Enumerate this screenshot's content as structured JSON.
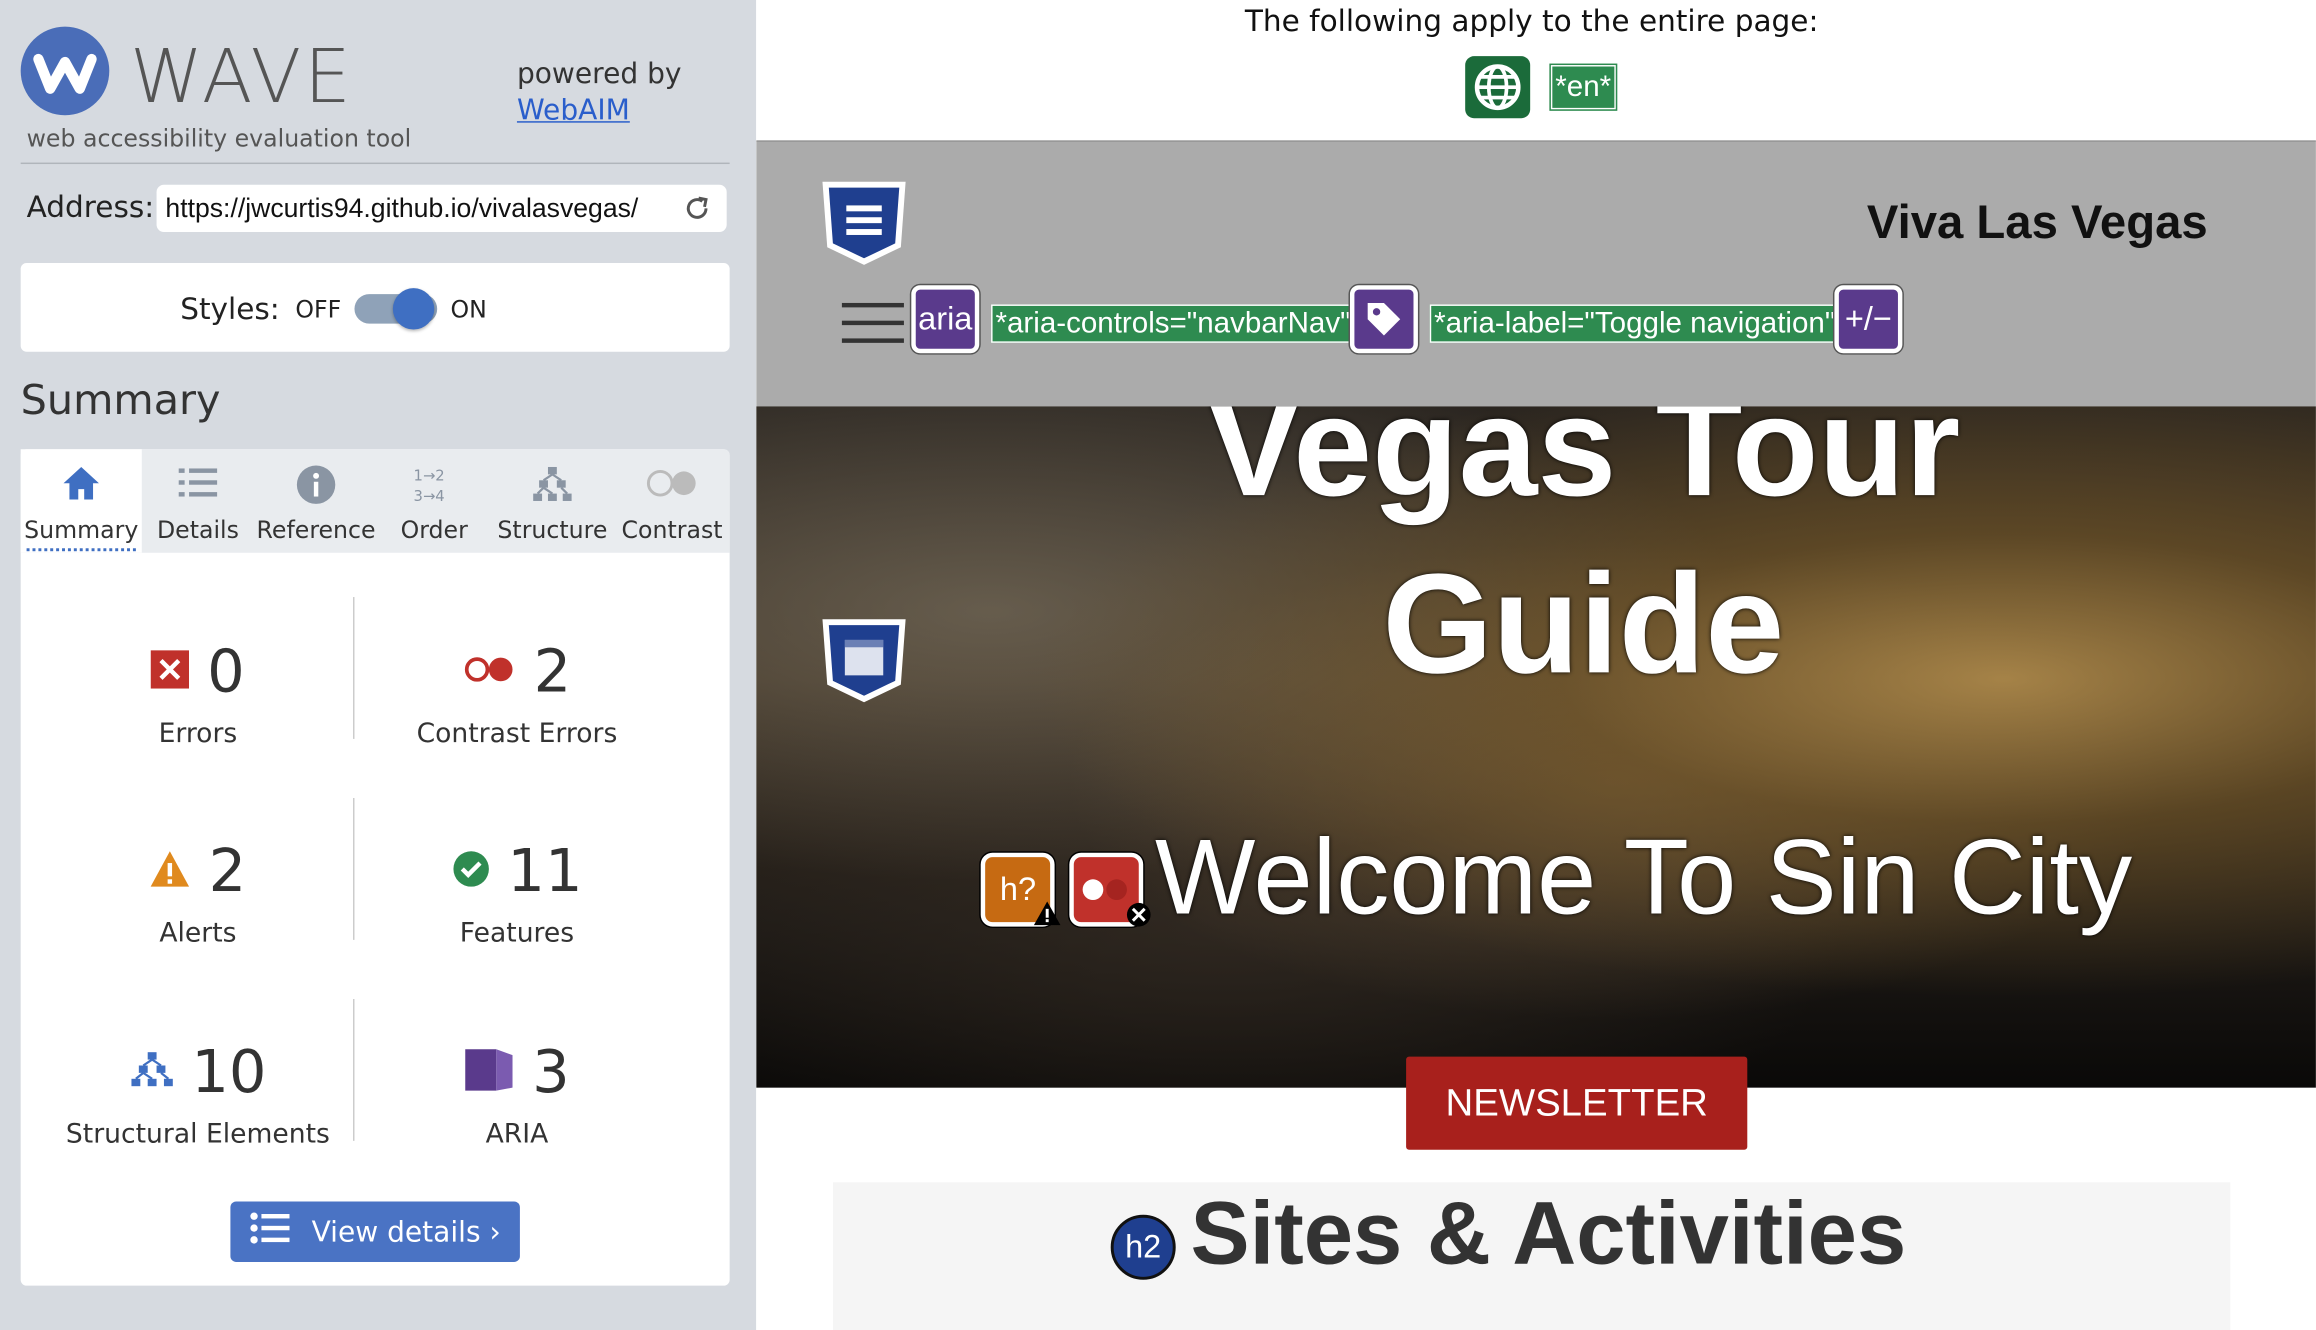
{
  "app": {
    "logo_text": "WAVE",
    "logo_subtitle": "web accessibility evaluation tool",
    "powered_by": "powered by",
    "powered_link": "WebAIM"
  },
  "address": {
    "label": "Address:",
    "value": "https://jwcurtis94.github.io/vivalasvegas/"
  },
  "styles": {
    "label": "Styles:",
    "off": "OFF",
    "on": "ON",
    "enabled": true
  },
  "summary": {
    "heading": "Summary",
    "tabs": [
      {
        "label": "Summary",
        "icon": "home-icon"
      },
      {
        "label": "Details",
        "icon": "list-icon"
      },
      {
        "label": "Reference",
        "icon": "info-icon"
      },
      {
        "label": "Order",
        "icon": "order-icon"
      },
      {
        "label": "Structure",
        "icon": "structure-icon"
      },
      {
        "label": "Contrast",
        "icon": "contrast-icon"
      }
    ],
    "active_tab": "Summary",
    "stats": {
      "errors": {
        "count": "0",
        "label": "Errors",
        "color": "#c0312b"
      },
      "contrast_errors": {
        "count": "2",
        "label": "Contrast Errors",
        "color": "#c0312b"
      },
      "alerts": {
        "count": "2",
        "label": "Alerts",
        "color": "#e08a1e"
      },
      "features": {
        "count": "11",
        "label": "Features",
        "color": "#2e8b50"
      },
      "structural": {
        "count": "10",
        "label": "Structural Elements",
        "color": "#3f6fc2"
      },
      "aria": {
        "count": "3",
        "label": "ARIA",
        "color": "#5a3a8c"
      }
    },
    "view_details": "View details ›"
  },
  "page": {
    "apply_text": "The following apply to the entire page:",
    "lang_badge": "*en*",
    "brand": "Viva Las Vegas",
    "aria_badge": "aria",
    "aria_controls": "*aria-controls=\"navbarNav\"*",
    "aria_label": "*aria-label=\"Toggle navigation\"*",
    "expand_badge": "+/−",
    "hero_title_line1": "Vegas Tour",
    "hero_title_line2": "Guide",
    "hero_subtitle": "Welcome To Sin City",
    "alert_badge": "h?",
    "newsletter": "NEWSLETTER",
    "h2_badge": "h2",
    "section_title": "Sites & Activities"
  }
}
